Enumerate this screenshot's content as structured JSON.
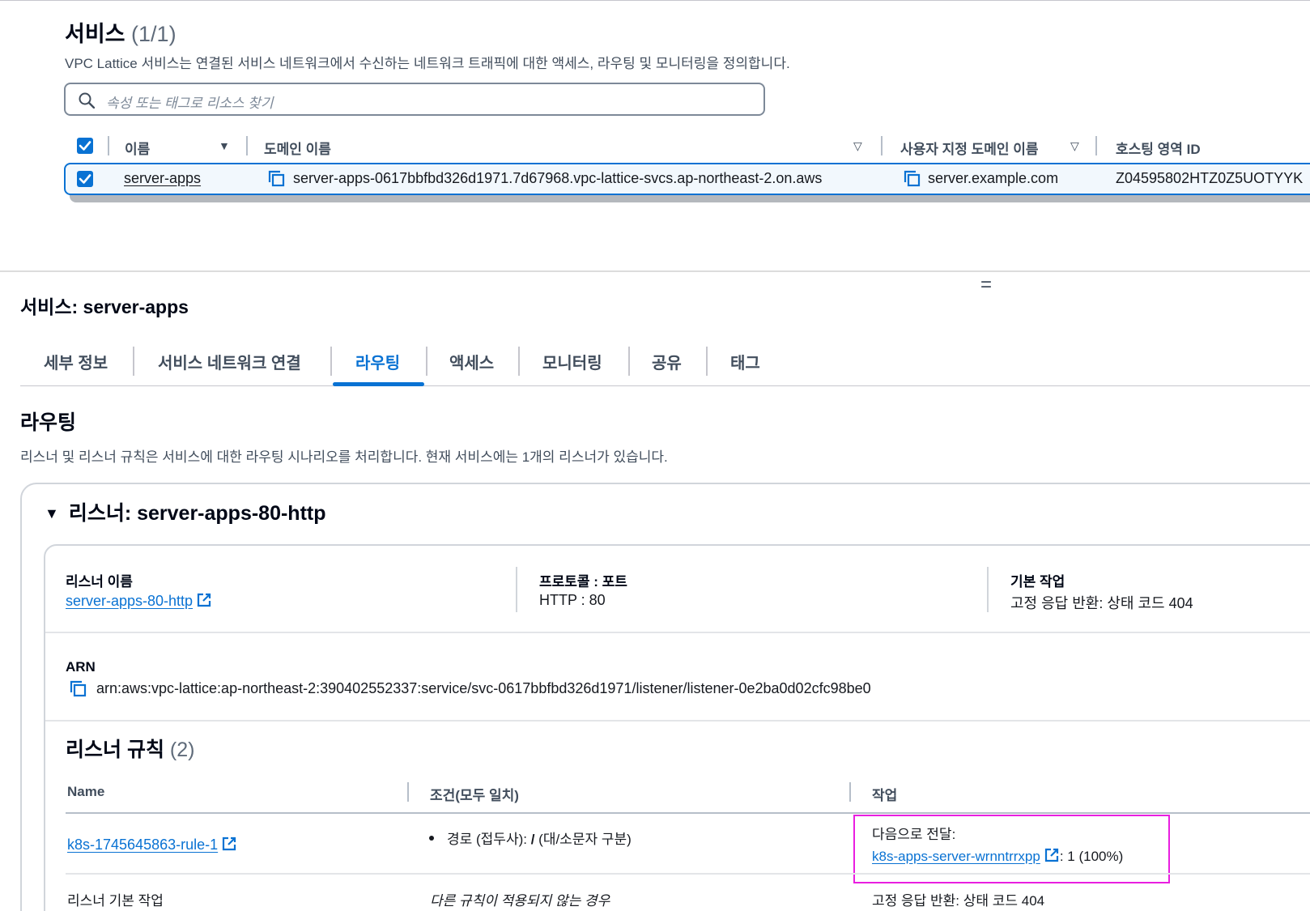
{
  "services": {
    "title": "서비스",
    "count": "(1/1)",
    "description": "VPC Lattice 서비스는 연결된 서비스 네트워크에서 수신하는 네트워크 트래픽에 대한 액세스, 라우팅 및 모니터링을 정의합니다.",
    "search_placeholder": "속성 또는 태그로 리소스 찾기",
    "columns": {
      "name": "이름",
      "domain": "도메인 이름",
      "custom_domain": "사용자 지정 도메인 이름",
      "hosted_zone": "호스팅 영역 ID"
    },
    "row": {
      "name": "server-apps",
      "domain": "server-apps-0617bbfbd326d1971.7d67968.vpc-lattice-svcs.ap-northeast-2.on.aws",
      "custom_domain": "server.example.com",
      "hosted_zone": "Z04595802HTZ0Z5UOTYYK"
    }
  },
  "service_detail": {
    "title": "서비스: server-apps",
    "tabs": [
      {
        "label": "세부 정보"
      },
      {
        "label": "서비스 네트워크 연결"
      },
      {
        "label": "라우팅"
      },
      {
        "label": "액세스"
      },
      {
        "label": "모니터링"
      },
      {
        "label": "공유"
      },
      {
        "label": "태그"
      }
    ],
    "active_tab": "라우팅"
  },
  "routing": {
    "heading": "라우팅",
    "description": "리스너 및 리스너 규칙은 서비스에 대한 라우팅 시나리오를 처리합니다. 현재 서비스에는 1개의 리스너가 있습니다.",
    "listener": {
      "title": "리스너: server-apps-80-http",
      "name_label": "리스너 이름",
      "name_value": "server-apps-80-http",
      "protocol_label": "프로토콜 : 포트",
      "protocol_value": "HTTP : 80",
      "default_action_label": "기본 작업",
      "default_action_value": "고정 응답 반환: 상태 코드 404",
      "arn_label": "ARN",
      "arn_value": "arn:aws:vpc-lattice:ap-northeast-2:390402552337:service/svc-0617bbfbd326d1971/listener/listener-0e2ba0d02cfc98be0"
    },
    "rules": {
      "title": "리스너 규칙",
      "count": "(2)",
      "columns": {
        "name": "Name",
        "conditions": "조건(모두 일치)",
        "action": "작업"
      },
      "rows": [
        {
          "name": "k8s-1745645863-rule-1",
          "condition_prefix": "경로 (접두사): ",
          "condition_path": "/",
          "condition_suffix": " (대/소문자 구분)",
          "action_label": "다음으로 전달:",
          "action_target": "k8s-apps-server-wrnntrrxpp",
          "action_weight": ": 1 (100%)"
        },
        {
          "name": "리스너 기본 작업",
          "condition": "다른 규칙이 적용되지 않는 경우",
          "action": "고정 응답 반환: 상태 코드 404"
        }
      ]
    }
  },
  "colors": {
    "accent": "#0972d3",
    "highlight": "#e91ee0",
    "text": "#16191f"
  }
}
